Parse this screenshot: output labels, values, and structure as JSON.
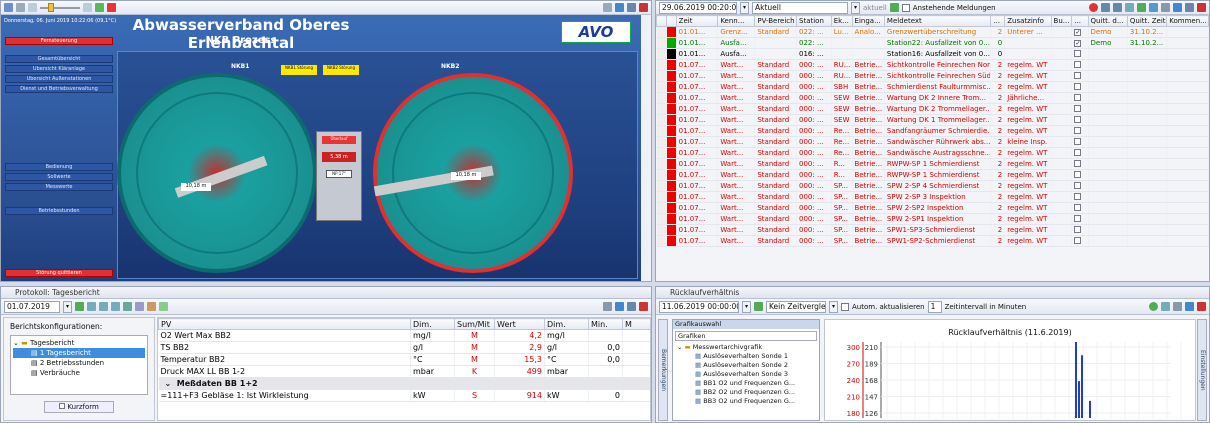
{
  "scada": {
    "date": "Donnerstag, 06. Juni 2019 10:22:06",
    "temp": "(09,1°C)",
    "title": "Abwasserverband Oberes Erlenbachtal",
    "subtitle": "NKB Prozess",
    "logo": "AVO",
    "nkb1": "NKB1",
    "nkb2": "NKB2",
    "menu": [
      "Gesamtübersicht",
      "Übersicht Kläranlage",
      "Übersicht Außenstationen",
      "Dienst und Betriebsverwaltung"
    ],
    "menu2": [
      "Bedienung",
      "Sollwerte",
      "Messwerte"
    ],
    "menu3": "Betriebsstunden",
    "top_red": "Fernsteuerung",
    "bottom_red": "Störung quittieren",
    "box1": "NKB1 Störung",
    "box2": "NKB2 Störung",
    "panel_label": "Überlauf",
    "panel_val": "5,38 m",
    "val_left": "10,18 m",
    "val_right": "10,18 m",
    "temp_box": "NP 17°"
  },
  "meld": {
    "datetime": "29.06.2019 00:20:00",
    "mode": "Aktuell",
    "aktuell": "aktuell",
    "anstehend": "Anstehende Meldungen",
    "cols": [
      "",
      "",
      "Zeit",
      "Kenn...",
      "PV-Bereich",
      "Station",
      "Ek...",
      "Einga...",
      "Meldetext",
      "...",
      "Zusatzinfo",
      "Bu...",
      "...",
      "Quitt. d...",
      "Quitt. Zeit",
      "Kommen..."
    ],
    "rows": [
      {
        "c": "#e00",
        "t": "01.01...",
        "k": "Grenz...",
        "pv": "Standard",
        "st": "022: ...",
        "ek": "Lu...",
        "e": "Analo...",
        "m": "Grenzwertüberschreitung",
        "n": "2",
        "z": "Unterer ...",
        "q": true,
        "qd": "Demo",
        "qz": "31.10.2...",
        "col": "#e07000"
      },
      {
        "c": "#0a0",
        "t": "01.01...",
        "k": "Ausfa...",
        "pv": "",
        "st": "022: ...",
        "ek": "",
        "e": "",
        "m": "Station22: Ausfallzeit von 0...",
        "n": "0",
        "z": "",
        "q": true,
        "qd": "Demo",
        "qz": "31.10.2...",
        "col": "#007700"
      },
      {
        "c": "#000",
        "t": "01.01...",
        "k": "Ausfa...",
        "pv": "",
        "st": "016: ...",
        "ek": "",
        "e": "",
        "m": "Station16: Ausfallzeit von 0...",
        "n": "0",
        "z": "",
        "q": false,
        "qd": "",
        "qz": "",
        "col": "#000"
      },
      {
        "c": "#e00",
        "t": "01.07...",
        "k": "Wart...",
        "pv": "Standard",
        "st": "000: ...",
        "ek": "RU...",
        "e": "Betrie...",
        "m": "Sichtkontrolle Feinrechen Nord",
        "n": "2",
        "z": "regelm. WT",
        "q": false,
        "qd": "",
        "qz": "",
        "col": "#d00"
      },
      {
        "c": "#e00",
        "t": "01.07...",
        "k": "Wart...",
        "pv": "Standard",
        "st": "000: ...",
        "ek": "RU...",
        "e": "Betrie...",
        "m": "Sichtkontrolle Feinrechen Süd",
        "n": "2",
        "z": "regelm. WT",
        "q": false,
        "qd": "",
        "qz": "",
        "col": "#d00"
      },
      {
        "c": "#e00",
        "t": "01.07...",
        "k": "Wart...",
        "pv": "Standard",
        "st": "000: ...",
        "ek": "SBH",
        "e": "Betrie...",
        "m": "Schmierdienst Faulturmmisc...",
        "n": "2",
        "z": "regelm. WT",
        "q": false,
        "qd": "",
        "qz": "",
        "col": "#d00"
      },
      {
        "c": "#e00",
        "t": "01.07...",
        "k": "Wart...",
        "pv": "Standard",
        "st": "000: ...",
        "ek": "SEW",
        "e": "Betrie...",
        "m": "Wartung DK 2 Innere Trom...",
        "n": "2",
        "z": "Jährliche...",
        "q": false,
        "qd": "",
        "qz": "",
        "col": "#d00"
      },
      {
        "c": "#e00",
        "t": "01.07...",
        "k": "Wart...",
        "pv": "Standard",
        "st": "000: ...",
        "ek": "SEW",
        "e": "Betrie...",
        "m": "Wartung DK 2 Trommellager...",
        "n": "2",
        "z": "regelm. WT",
        "q": false,
        "qd": "",
        "qz": "",
        "col": "#d00"
      },
      {
        "c": "#e00",
        "t": "01.07...",
        "k": "Wart...",
        "pv": "Standard",
        "st": "000: ...",
        "ek": "SEW",
        "e": "Betrie...",
        "m": "Wartung DK 1 Trommellager...",
        "n": "2",
        "z": "regelm. WT",
        "q": false,
        "qd": "",
        "qz": "",
        "col": "#d00"
      },
      {
        "c": "#e00",
        "t": "01.07...",
        "k": "Wart...",
        "pv": "Standard",
        "st": "000: ...",
        "ek": "Re...",
        "e": "Betrie...",
        "m": "Sandfangräumer Schmierdie...",
        "n": "2",
        "z": "regelm. WT",
        "q": false,
        "qd": "",
        "qz": "",
        "col": "#d00"
      },
      {
        "c": "#e00",
        "t": "01.07...",
        "k": "Wart...",
        "pv": "Standard",
        "st": "000: ...",
        "ek": "Re...",
        "e": "Betrie...",
        "m": "Sandwäscher Rührwerk abs...",
        "n": "2",
        "z": "kleine Insp.",
        "q": false,
        "qd": "",
        "qz": "",
        "col": "#d00"
      },
      {
        "c": "#e00",
        "t": "01.07...",
        "k": "Wart...",
        "pv": "Standard",
        "st": "000: ...",
        "ek": "Re...",
        "e": "Betrie...",
        "m": "Sandwäsche Austragsschne...",
        "n": "2",
        "z": "regelm. WT",
        "q": false,
        "qd": "",
        "qz": "",
        "col": "#d00"
      },
      {
        "c": "#e00",
        "t": "01.07...",
        "k": "Wart...",
        "pv": "Standard",
        "st": "000: ...",
        "ek": "R...",
        "e": "Betrie...",
        "m": "RWPW-SP 1 Schmierdienst",
        "n": "2",
        "z": "regelm. WT",
        "q": false,
        "qd": "",
        "qz": "",
        "col": "#d00"
      },
      {
        "c": "#e00",
        "t": "01.07...",
        "k": "Wart...",
        "pv": "Standard",
        "st": "000: ...",
        "ek": "R...",
        "e": "Betrie...",
        "m": "RWPW-SP 1 Schmierdienst",
        "n": "2",
        "z": "regelm. WT",
        "q": false,
        "qd": "",
        "qz": "",
        "col": "#d00"
      },
      {
        "c": "#e00",
        "t": "01.07...",
        "k": "Wart...",
        "pv": "Standard",
        "st": "000: ...",
        "ek": "SP...",
        "e": "Betrie...",
        "m": "SPW 2-SP 4 Schmierdienst",
        "n": "2",
        "z": "regelm. WT",
        "q": false,
        "qd": "",
        "qz": "",
        "col": "#d00"
      },
      {
        "c": "#e00",
        "t": "01.07...",
        "k": "Wart...",
        "pv": "Standard",
        "st": "000: ...",
        "ek": "SP...",
        "e": "Betrie...",
        "m": "SPW 2-SP 3 Inspektion",
        "n": "2",
        "z": "regelm. WT",
        "q": false,
        "qd": "",
        "qz": "",
        "col": "#d00"
      },
      {
        "c": "#e00",
        "t": "01.07...",
        "k": "Wart...",
        "pv": "Standard",
        "st": "000: ...",
        "ek": "SP...",
        "e": "Betrie...",
        "m": "SPW 2-SP2 Inspektion",
        "n": "2",
        "z": "regelm. WT",
        "q": false,
        "qd": "",
        "qz": "",
        "col": "#d00"
      },
      {
        "c": "#e00",
        "t": "01.07...",
        "k": "Wart...",
        "pv": "Standard",
        "st": "000: ...",
        "ek": "SP...",
        "e": "Betrie...",
        "m": "SPW 2-SP1 Inspektion",
        "n": "2",
        "z": "regelm. WT",
        "q": false,
        "qd": "",
        "qz": "",
        "col": "#d00"
      },
      {
        "c": "#e00",
        "t": "01.07...",
        "k": "Wart...",
        "pv": "Standard",
        "st": "000: ...",
        "ek": "SP...",
        "e": "Betrie...",
        "m": "SPW1-SP3-Schmierdienst",
        "n": "2",
        "z": "regelm. WT",
        "q": false,
        "qd": "",
        "qz": "",
        "col": "#d00"
      },
      {
        "c": "#e00",
        "t": "01.07...",
        "k": "Wart...",
        "pv": "Standard",
        "st": "000: ...",
        "ek": "SP...",
        "e": "Betrie...",
        "m": "SPW1-SP2-Schmierdienst",
        "n": "2",
        "z": "regelm. WT",
        "q": false,
        "qd": "",
        "qz": "",
        "col": "#d00"
      }
    ]
  },
  "prot": {
    "title": "Protokoll: Tagesbericht",
    "date": "01.07.2019",
    "configs_label": "Berichtskonfigurationen:",
    "tree": [
      "Tagesbericht",
      "1 Tagesbericht",
      "2 Betriebsstunden",
      "Verbräuche"
    ],
    "kurzform": "Kurzform",
    "cols": [
      "PV",
      "Dim.",
      "Sum/Mit",
      "Wert",
      "Dim.",
      "Min.",
      "M"
    ],
    "rows": [
      {
        "pv": "O2 Wert Max BB2",
        "d": "mg/l",
        "s": "M",
        "w": "4,2",
        "d2": "mg/l",
        "min": ""
      },
      {
        "pv": "TS BB2",
        "d": "g/l",
        "s": "M",
        "w": "2,9",
        "d2": "g/l",
        "min": "0,0"
      },
      {
        "pv": "Temperatur BB2",
        "d": "°C",
        "s": "M",
        "w": "15,3",
        "d2": "°C",
        "min": "0,0"
      },
      {
        "pv": "Druck MAX LL BB 1-2",
        "d": "mbar",
        "s": "K",
        "w": "499",
        "d2": "mbar",
        "min": ""
      }
    ],
    "group": "Meßdaten BB 1+2",
    "last": {
      "pv": "=111+F3 Gebläse 1: Ist Wirkleistung",
      "d": "kW",
      "s": "S",
      "w": "914",
      "d2": "kW",
      "min": "0"
    }
  },
  "rueck": {
    "title": "Rücklaufverhältnis",
    "datetime": "11.06.2019 00:00:00",
    "vergleich": "Kein Zeitvergleich",
    "auto": "Autom. aktualisieren",
    "interval": "1",
    "interval_label": "Zeitintervall in Minuten",
    "side_left": "Bemerkungen",
    "side_right": "Einstellungen",
    "grafikauswahl": "Grafikauswahl",
    "grafiken": "Grafiken",
    "tree_root": "Messwertarchivgrafik",
    "tree": [
      "Auslöseverhalten Sonde 1",
      "Auslöseverhalten Sonde 2",
      "Auslöseverhalten Sonde 3",
      "BB1 O2 und Frequenzen G...",
      "BB2 O2 und Frequenzen G...",
      "BB3 O2 und Frequenzen G..."
    ]
  },
  "chart_data": {
    "type": "bar",
    "title": "Rücklaufverhältnis (11.6.2019)",
    "y_left_ticks": [
      300,
      270,
      240,
      210,
      180
    ],
    "y_right_ticks": [
      210,
      189,
      168,
      147,
      126
    ],
    "ylim": [
      180,
      300
    ],
    "spike_values": [
      315,
      238,
      285,
      202
    ],
    "colors": {
      "left_axis": "#d00000",
      "spike": "#2040c0"
    }
  }
}
